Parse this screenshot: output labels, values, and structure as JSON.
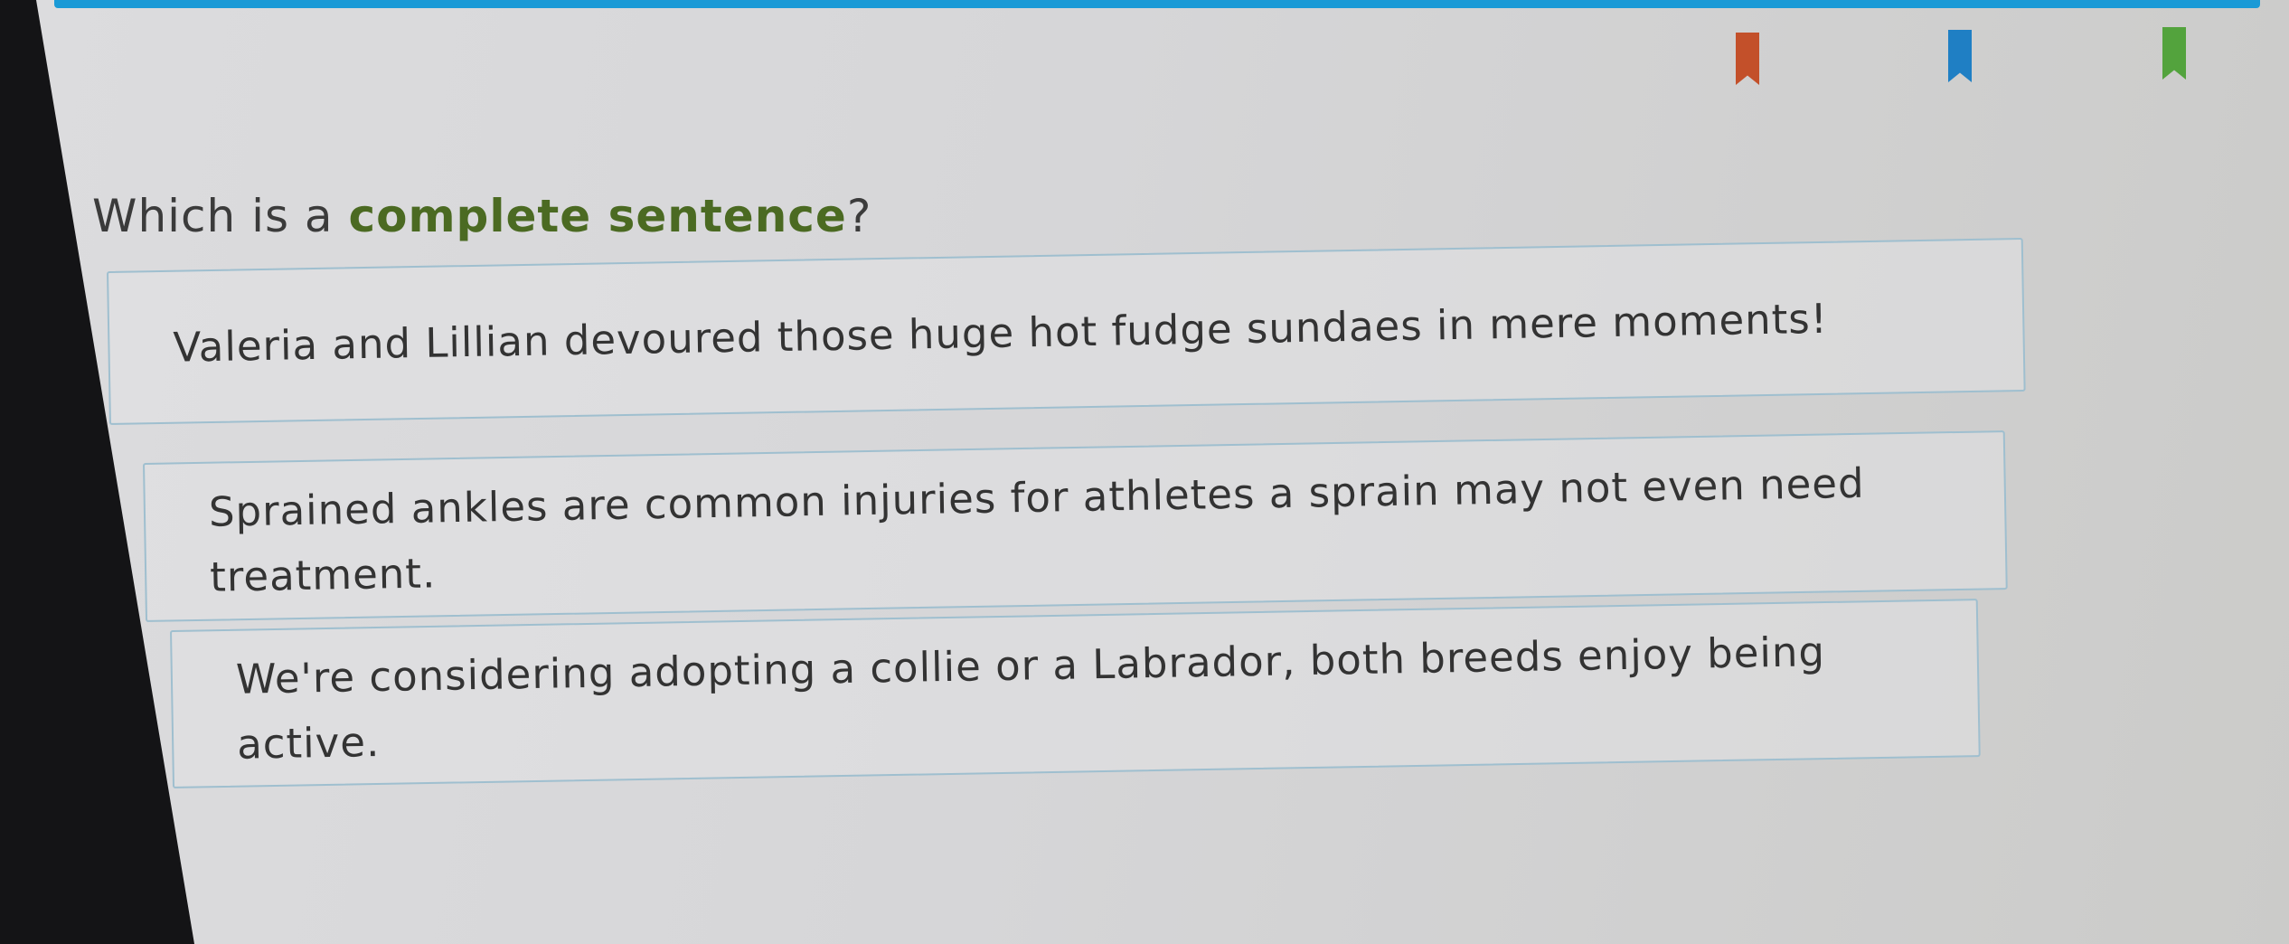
{
  "question": {
    "prefix": "Which is a ",
    "emphasis": "complete sentence",
    "suffix": "?"
  },
  "choices": [
    {
      "text": "Valeria and Lillian devoured those huge hot fudge sundaes in mere moments!"
    },
    {
      "text": "Sprained ankles are common injuries for athletes a sprain may not even need treatment."
    },
    {
      "text": "We're considering adopting a collie or a Labrador, both breeds enjoy being active."
    }
  ],
  "bookmarks": [
    {
      "icon": "bookmark-icon",
      "color": "#c3502a"
    },
    {
      "icon": "bookmark-icon",
      "color": "#1f7fc4"
    },
    {
      "icon": "bookmark-icon",
      "color": "#53a33d"
    }
  ],
  "colors": {
    "accent_bar": "#1a9ad6",
    "emphasis_text": "#4b6a22",
    "choice_border": "#9fbfcf"
  }
}
